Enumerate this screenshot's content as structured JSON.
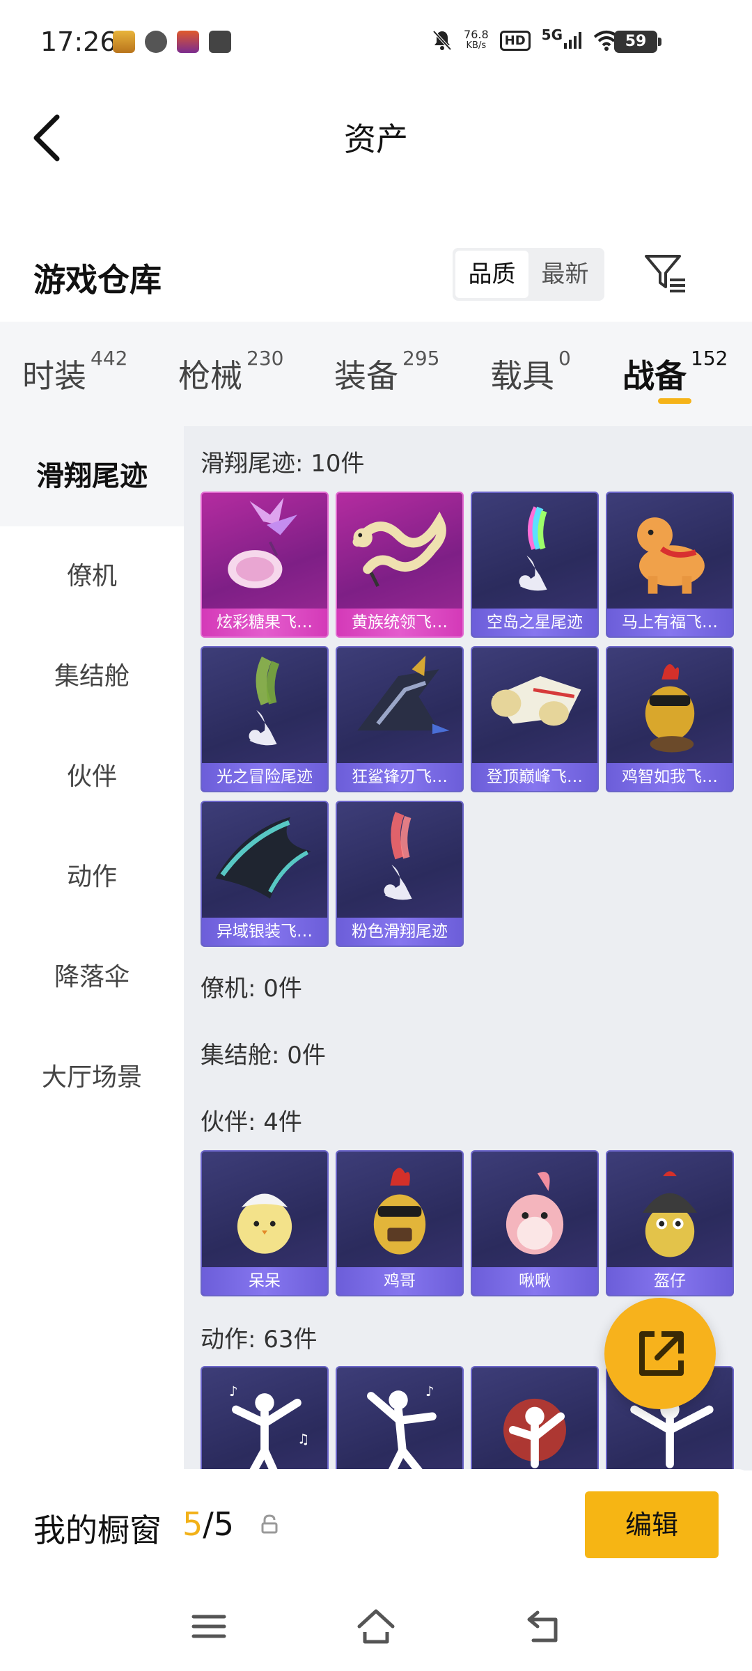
{
  "status": {
    "time": "17:26",
    "net_speed_value": "76.8",
    "net_speed_unit": "KB/s",
    "hd": "HD",
    "signal": "5G",
    "battery": "59"
  },
  "header": {
    "title": "资产"
  },
  "warehouse": {
    "title": "游戏仓库",
    "sort_options": [
      "品质",
      "最新"
    ],
    "active_sort": "品质"
  },
  "tabs": [
    {
      "label": "时装",
      "count": "442"
    },
    {
      "label": "枪械",
      "count": "230"
    },
    {
      "label": "装备",
      "count": "295"
    },
    {
      "label": "载具",
      "count": "0"
    },
    {
      "label": "战备",
      "count": "152",
      "active": true
    }
  ],
  "sidebar": {
    "items": [
      "滑翔尾迹",
      "僚机",
      "集结舱",
      "伙伴",
      "动作",
      "降落伞",
      "大厅场景"
    ],
    "active": "滑翔尾迹"
  },
  "sections": [
    {
      "title": "滑翔尾迹: 10件",
      "items": [
        {
          "name": "炫彩糖果飞…",
          "rarity": "pink",
          "icon": "candy-wings-icon"
        },
        {
          "name": "黄族统领飞…",
          "rarity": "pink",
          "icon": "golden-dragon-icon"
        },
        {
          "name": "空岛之星尾迹",
          "rarity": "blue",
          "icon": "rainbow-smoke-icon"
        },
        {
          "name": "马上有福飞…",
          "rarity": "blue",
          "icon": "pony-icon"
        },
        {
          "name": "光之冒险尾迹",
          "rarity": "blue",
          "icon": "green-smoke-icon"
        },
        {
          "name": "狂鲨锋刃飞…",
          "rarity": "blue",
          "icon": "shark-glider-icon"
        },
        {
          "name": "登顶巅峰飞…",
          "rarity": "blue",
          "icon": "jet-glider-icon"
        },
        {
          "name": "鸡智如我飞…",
          "rarity": "blue",
          "icon": "chicken-glider-icon"
        },
        {
          "name": "异域银装飞…",
          "rarity": "blue",
          "icon": "alien-glider-icon"
        },
        {
          "name": "粉色滑翔尾迹",
          "rarity": "blue",
          "icon": "pink-smoke-icon"
        }
      ]
    },
    {
      "title": "僚机: 0件",
      "items": []
    },
    {
      "title": "集结舱: 0件",
      "items": []
    },
    {
      "title": "伙伴: 4件",
      "items": [
        {
          "name": "呆呆",
          "rarity": "blue",
          "icon": "chick-icon"
        },
        {
          "name": "鸡哥",
          "rarity": "blue",
          "icon": "rooster-icon"
        },
        {
          "name": "啾啾",
          "rarity": "blue",
          "icon": "pink-bird-icon"
        },
        {
          "name": "盔仔",
          "rarity": "blue",
          "icon": "helmet-chick-icon"
        }
      ]
    },
    {
      "title": "动作: 63件",
      "items": [
        {
          "name": "",
          "rarity": "blue",
          "icon": "dance-pose-icon"
        },
        {
          "name": "",
          "rarity": "blue",
          "icon": "dance-pose-icon"
        },
        {
          "name": "",
          "rarity": "blue",
          "icon": "dance-pose-icon"
        },
        {
          "name": "",
          "rarity": "blue",
          "icon": "dance-pose-icon"
        }
      ]
    }
  ],
  "showcase": {
    "label": "我的橱窗",
    "current": "5",
    "separator": "/",
    "total": "5",
    "edit_label": "编辑"
  },
  "colors": {
    "accent": "#f6b514",
    "pink_card": "#b42ca0",
    "blue_card": "#2b2b5d",
    "card_footer": "#7c6be8"
  }
}
